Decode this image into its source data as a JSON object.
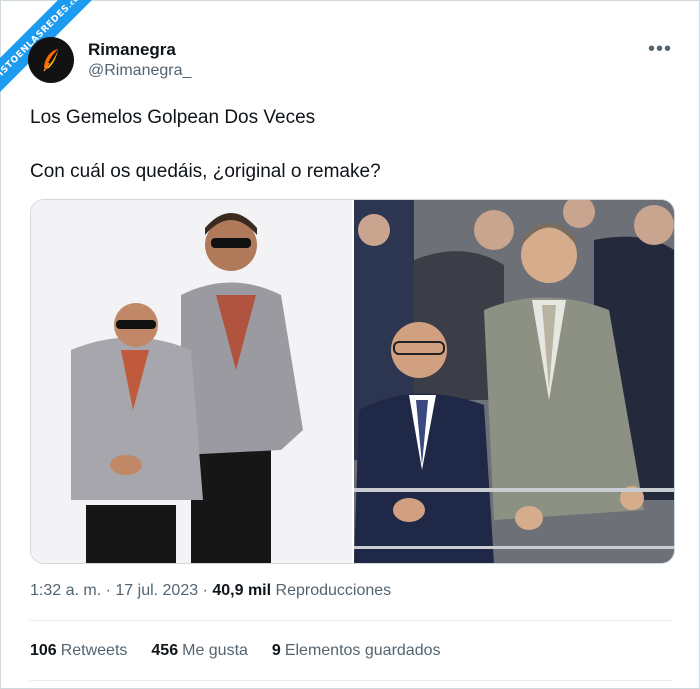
{
  "watermark": "VISTOENLASREDES",
  "watermark_domain": ".com",
  "user": {
    "display_name": "Rimanegra",
    "handle": "@Rimanegra_"
  },
  "tweet": {
    "line1": "Los Gemelos Golpean Dos Veces",
    "line2": "Con cuál os quedáis, ¿original o remake?"
  },
  "meta": {
    "time": "1:32 a. m.",
    "date": "17 jul. 2023",
    "views_count": "40,9 mil",
    "views_label": "Reproducciones"
  },
  "stats": {
    "retweets_count": "106",
    "retweets_label": "Retweets",
    "likes_count": "456",
    "likes_label": "Me gusta",
    "saved_count": "9",
    "saved_label": "Elementos guardados"
  },
  "colors": {
    "accent": "#1d9bf0",
    "text": "#0f1419",
    "secondary": "#536471"
  }
}
